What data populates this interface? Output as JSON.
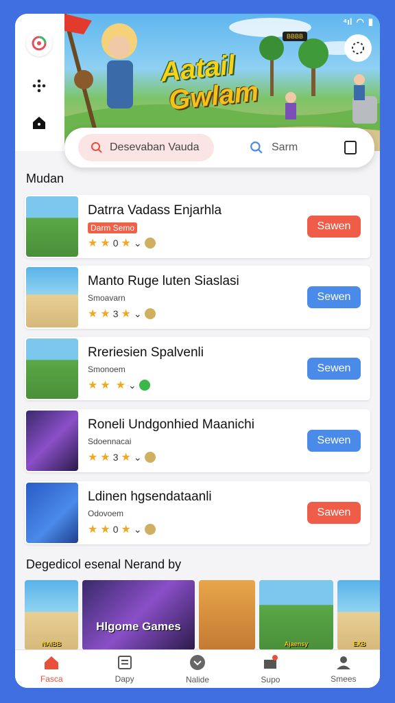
{
  "status_bar": {
    "text": "⁴ıl"
  },
  "hero": {
    "title_line1": "Aatail",
    "title_line2": "Gwlam",
    "badge": "BBBB"
  },
  "search": {
    "primary_label": "Desevaban Vauda",
    "secondary_label": "Sarm"
  },
  "sections": {
    "list_title": "Mudan",
    "recommended_title": "Degedicol esenal Nerand by"
  },
  "games": [
    {
      "title": "Datrra Vadass Enjarhla",
      "subtitle": "Darm Semo",
      "subtitle_style": "tag",
      "rating": "0",
      "button": "Sawen",
      "button_color": "#ef5c48",
      "thumb": "field"
    },
    {
      "title": "Manto Ruge luten Siaslasi",
      "subtitle": "Smoavarn",
      "subtitle_style": "plain",
      "rating": "3",
      "button": "Sewen",
      "button_color": "#4a8ae8",
      "thumb": "beach"
    },
    {
      "title": "Rreriesien Spalvenli",
      "subtitle": "Smonoem",
      "subtitle_style": "plain",
      "rating": "",
      "button": "Sewen",
      "button_color": "#4a8ae8",
      "thumb": "field"
    },
    {
      "title": "Roneli Undgonhied Maanichi",
      "subtitle": "Sdoennacai",
      "subtitle_style": "plain",
      "rating": "3",
      "button": "Sewen",
      "button_color": "#4a8ae8",
      "thumb": "purple"
    },
    {
      "title": "Ldinen hgsendataanli",
      "subtitle": "Odovoem",
      "subtitle_style": "plain",
      "rating": "0",
      "button": "Sawen",
      "button_color": "#ef5c48",
      "thumb": "blue"
    }
  ],
  "recommended": [
    {
      "caption": "NAIBB",
      "theme": "beach"
    },
    {
      "caption": "Hlgome Games",
      "theme": "purple"
    },
    {
      "caption": "",
      "theme": "portrait"
    },
    {
      "caption": "Ajaensy",
      "theme": "field"
    },
    {
      "caption": "EXB",
      "theme": "beach"
    }
  ],
  "nav": [
    {
      "label": "Fasca",
      "icon": "home-icon",
      "active": true
    },
    {
      "label": "Dapy",
      "icon": "news-icon",
      "active": false
    },
    {
      "label": "Nalide",
      "icon": "chevron-circle-icon",
      "active": false
    },
    {
      "label": "Supo",
      "icon": "bag-icon",
      "active": false
    },
    {
      "label": "Smees",
      "icon": "profile-icon",
      "active": false
    }
  ],
  "colors": {
    "accent_red": "#e8503a",
    "accent_blue": "#4a8ae8",
    "background": "#3f6fe0"
  }
}
